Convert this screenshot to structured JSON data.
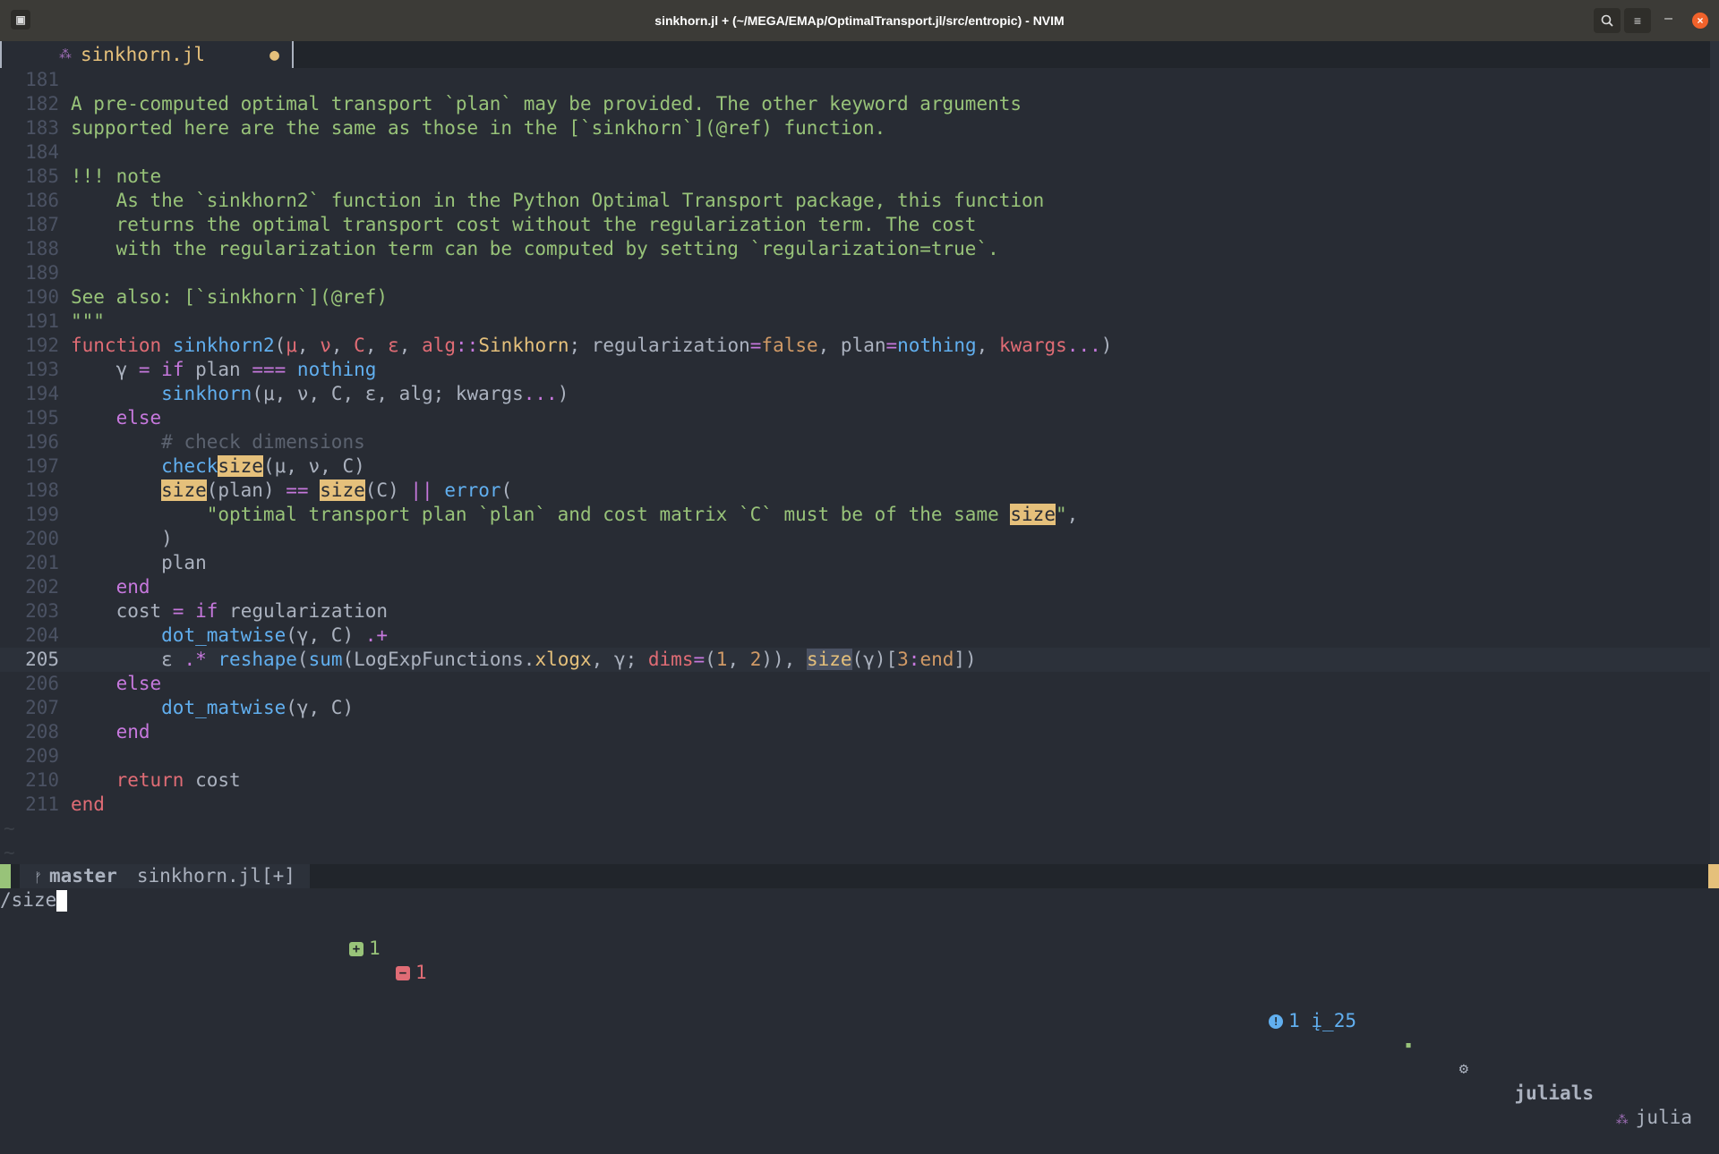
{
  "window": {
    "title": "sinkhorn.jl + (~/MEGA/EMAp/OptimalTransport.jl/src/entropic) - NVIM",
    "search_icon": "search-icon",
    "menu_icon": "hamburger-menu-icon",
    "minimize_label": "–",
    "close_label": "×"
  },
  "tab": {
    "filename": "sinkhorn.jl",
    "modified_marker": "●"
  },
  "lines": [
    {
      "n": "181"
    },
    {
      "n": "182"
    },
    {
      "n": "183"
    },
    {
      "n": "184"
    },
    {
      "n": "185"
    },
    {
      "n": "186"
    },
    {
      "n": "187"
    },
    {
      "n": "188"
    },
    {
      "n": "189"
    },
    {
      "n": "190"
    },
    {
      "n": "191"
    },
    {
      "n": "192"
    },
    {
      "n": "193"
    },
    {
      "n": "194"
    },
    {
      "n": "195"
    },
    {
      "n": "196"
    },
    {
      "n": "197"
    },
    {
      "n": "198"
    },
    {
      "n": "199"
    },
    {
      "n": "200"
    },
    {
      "n": "201"
    },
    {
      "n": "202"
    },
    {
      "n": "203"
    },
    {
      "n": "204"
    },
    {
      "n": "205"
    },
    {
      "n": "206"
    },
    {
      "n": "207"
    },
    {
      "n": "208"
    },
    {
      "n": "209"
    },
    {
      "n": "210"
    },
    {
      "n": "211"
    }
  ],
  "code": {
    "l182": "A pre-computed optimal transport `plan` may be provided. The other keyword arguments",
    "l183": "supported here are the same as those in the [`sinkhorn`](@ref) function.",
    "l185": "!!! note",
    "l186": "    As the `sinkhorn2` function in the Python Optimal Transport package, this function",
    "l187": "    returns the optimal transport cost without the regularization term. The cost",
    "l188": "    with the regularization term can be computed by setting `regularization=true`.",
    "l190": "See also: [`sinkhorn`](@ref)",
    "l191": "\"\"\"",
    "l192": {
      "kw": "function",
      "fn": "sinkhorn2",
      "p1": "(",
      "a1": "μ",
      "c1": ", ",
      "a2": "ν",
      "c2": ", ",
      "a3": "C",
      "c3": ", ",
      "a4": "ε",
      "c4": ", ",
      "a5": "alg",
      "op": "::",
      "ty": "Sinkhorn",
      "c5": "; regularization",
      "eq": "=",
      "fa": "false",
      "c6": ", plan",
      "eq2": "=",
      "no": "nothing",
      "c7": ", ",
      "kw2": "kwargs",
      "dots": "...",
      "p2": ")"
    },
    "l193": {
      "ind": "    ",
      "v": "γ",
      "eq": " = ",
      "kw": "if",
      "mid": " plan ",
      "op": "===",
      "sp": " ",
      "no": "nothing"
    },
    "l194": {
      "ind": "        ",
      "fn": "sinkhorn",
      "args": "(μ, ν, C, ε, alg; kwargs",
      "dots": "...",
      "end": ")"
    },
    "l195": {
      "ind": "    ",
      "kw": "else"
    },
    "l196": {
      "ind": "        ",
      "cm": "# check dimensions"
    },
    "l197": {
      "ind": "        ",
      "fn": "check",
      "hl": "size",
      "rest": "(μ, ν, C)"
    },
    "l198": {
      "ind": "        ",
      "hl1": "size",
      "a": "(plan) ",
      "op": "==",
      "sp": " ",
      "hl2": "size",
      "b": "(C) ",
      "op2": "||",
      "sp2": " ",
      "fn": "error",
      "p": "("
    },
    "l199": {
      "ind": "            ",
      "str": "\"optimal transport plan `plan` and cost matrix `C` must be of the same ",
      "hl": "size",
      "str2": "\"",
      "end": ","
    },
    "l200": "        )",
    "l201": "        plan",
    "l202": {
      "ind": "    ",
      "kw": "end"
    },
    "l203": {
      "ind": "    ",
      "a": "cost ",
      "op": "=",
      "sp": " ",
      "kw": "if",
      "rest": " regularization"
    },
    "l204": {
      "ind": "        ",
      "fn": "dot_matwise",
      "args": "(γ, C) ",
      "op": ".+"
    },
    "l205": {
      "ind": "        ",
      "a": "ε ",
      "op": ".*",
      "sp": " ",
      "fn": "reshape",
      "p": "(",
      "fn2": "sum",
      "b": "(LogExpFunctions.",
      "fn3": "xlogx",
      "c": ", γ; ",
      "kw": "dims",
      "eq": "=",
      "p2": "(",
      "n1": "1",
      "cm": ", ",
      "n2": "2",
      "e": ")), ",
      "hl": "size",
      "f": "(γ)[",
      "n3": "3",
      "col": ":",
      "en": "end",
      "g": "])"
    },
    "l206": {
      "ind": "    ",
      "kw": "else"
    },
    "l207": {
      "ind": "        ",
      "fn": "dot_matwise",
      "args": "(γ, C)"
    },
    "l208": {
      "ind": "    ",
      "kw": "end"
    },
    "l210": {
      "ind": "    ",
      "kw": "return",
      "rest": " cost"
    },
    "l211": {
      "kw": "end"
    }
  },
  "tildes": [
    "~",
    "~"
  ],
  "statusline": {
    "branch_icon": "git-branch-icon",
    "branch": "master",
    "file": "sinkhorn.jl[+]",
    "added": "1",
    "removed": "1",
    "diagnostics": "1",
    "lsp_progress": "25",
    "lsp_server": "julials",
    "language": "julia"
  },
  "cmdline": {
    "text": "/size"
  },
  "colors": {
    "background": "#282c34",
    "string": "#98c379",
    "keyword": "#c678dd",
    "function": "#61afef",
    "highlight": "#e5c07b"
  }
}
